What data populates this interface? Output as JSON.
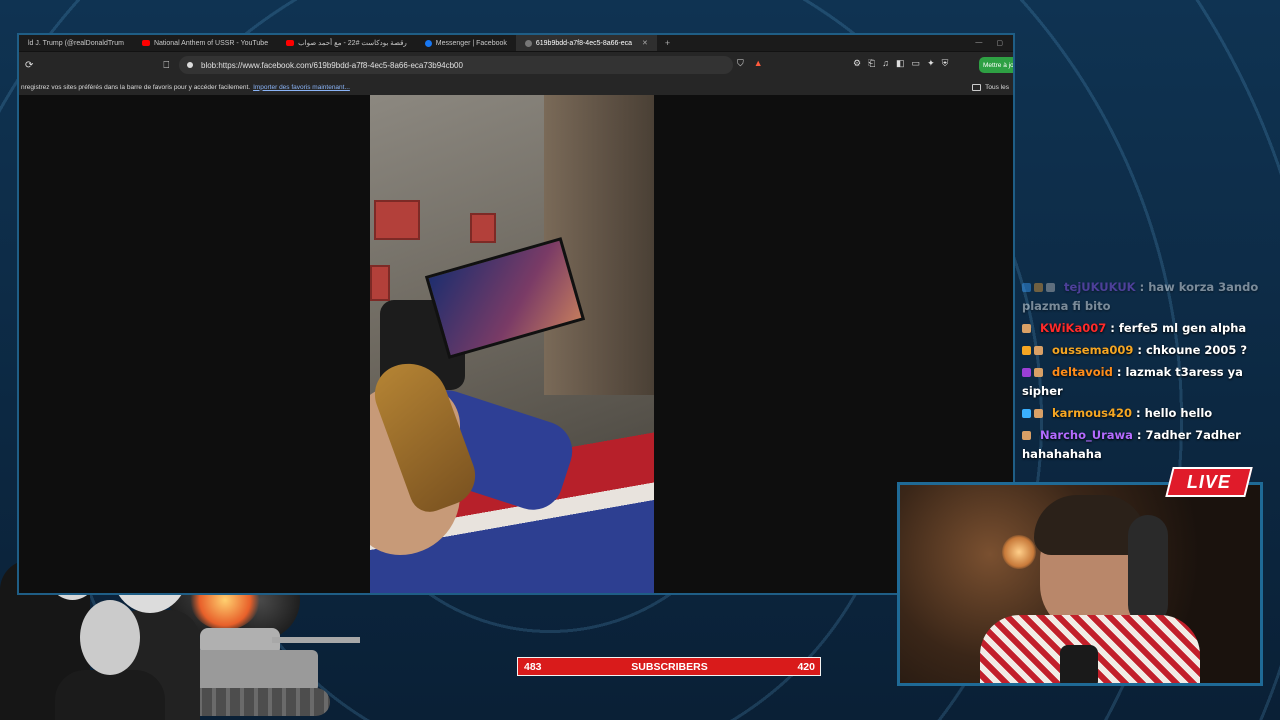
{
  "browser": {
    "tabs": [
      {
        "label": "ld J. Trump (@realDonaldTrum",
        "favicon_color": "#333333"
      },
      {
        "label": "National Anthem of USSR - YouTube",
        "favicon_color": "#ff0000"
      },
      {
        "label": "رقصة بودكاست #22 - مع أحمد صواب",
        "favicon_color": "#ff0000"
      },
      {
        "label": "Messenger | Facebook",
        "favicon_color": "#1877f2"
      },
      {
        "label": "619b9bdd-a7f8-4ec5-8a66-eca",
        "favicon_color": "#666666",
        "active": true
      }
    ],
    "url": "blob:https://www.facebook.com/619b9bdd-a7f8-4ec5-8a66-eca73b94cb00",
    "update_button": "Mettre à jo",
    "favorites_bar": {
      "text": "nregistrez vos sites préférés dans la barre de favoris pour y accéder facilement.",
      "link": "Importer des favoris maintenant...",
      "all_favorites": "Tous les"
    }
  },
  "chat": {
    "messages": [
      {
        "user": "tejUKUKUK",
        "text": ": haw korza 3ando plazma fi bito",
        "color": "#9b59ff",
        "badges": [
          "#3aa0ff",
          "#e8a23a",
          "#c0c0c0"
        ],
        "faded": true
      },
      {
        "user": "KWiKa007",
        "text": ": ferfe5 ml gen alpha",
        "color": "#ff2a2a",
        "badges": [
          "#d9a066"
        ]
      },
      {
        "user": "oussema009",
        "text": ": chkoune 2005 ?",
        "color": "#f5a623",
        "badges": [
          "#f5a623",
          "#d9a066"
        ]
      },
      {
        "user": "deltavoid",
        "text": ": lazmak t3aress ya sipher",
        "color": "#ff8c1a",
        "badges": [
          "#9b3fd6",
          "#d9a066"
        ]
      },
      {
        "user": "karmous420",
        "text": ": hello hello",
        "color": "#f5a623",
        "badges": [
          "#3ab0ff",
          "#d9a066"
        ]
      },
      {
        "user": "Narcho_Urawa",
        "text": ": 7adher 7adher hahahahaha",
        "color": "#b36bff",
        "badges": [
          "#d9a066"
        ]
      }
    ]
  },
  "overlay": {
    "live_label": "LIVE",
    "subscribers": {
      "left": "483",
      "label": "SUBSCRIBERS",
      "right": "420"
    }
  }
}
